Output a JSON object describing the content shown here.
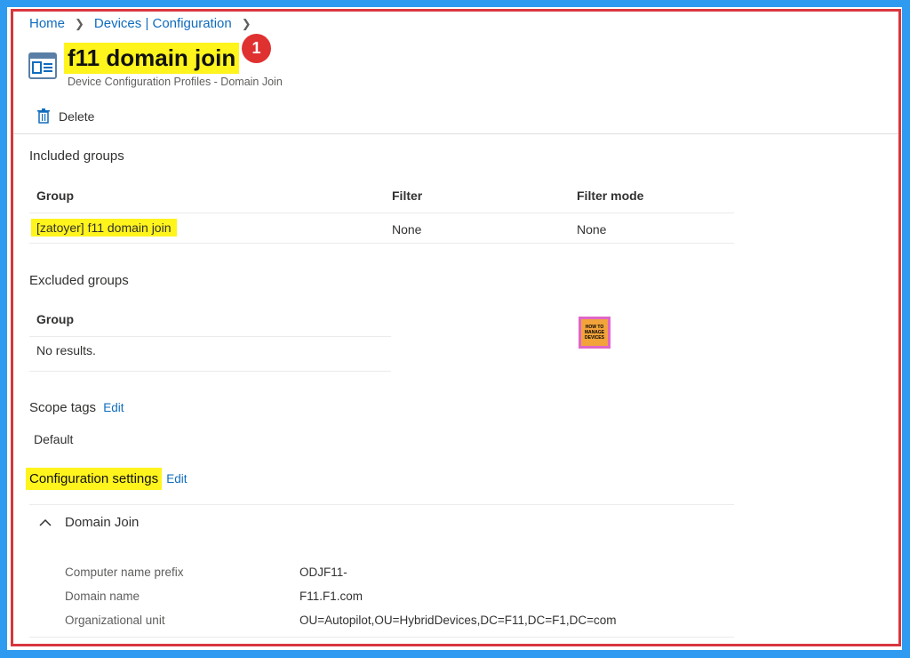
{
  "breadcrumb": {
    "home": "Home",
    "devices_config": "Devices | Configuration"
  },
  "header": {
    "title": "f11 domain join",
    "subtitle": "Device Configuration Profiles - Domain Join",
    "step_badge": "1"
  },
  "toolbar": {
    "delete_label": "Delete"
  },
  "included_groups": {
    "title": "Included groups",
    "columns": [
      "Group",
      "Filter",
      "Filter mode"
    ],
    "rows": [
      {
        "group": "[zatoyer] f11 domain join",
        "filter": "None",
        "filter_mode": "None"
      }
    ]
  },
  "excluded_groups": {
    "title": "Excluded groups",
    "column": "Group",
    "empty": "No results."
  },
  "scope_tags": {
    "title": "Scope tags",
    "edit_label": "Edit",
    "value": "Default"
  },
  "configuration_settings": {
    "title": "Configuration settings",
    "edit_label": "Edit",
    "section": "Domain Join",
    "items": [
      {
        "label": "Computer name prefix",
        "value": "ODJF11-"
      },
      {
        "label": "Domain name",
        "value": "F11.F1.com"
      },
      {
        "label": "Organizational unit",
        "value": "OU=Autopilot,OU=HybridDevices,DC=F11,DC=F1,DC=com"
      }
    ]
  },
  "logo": {
    "line1": "HOW TO",
    "line2": "MANAGE",
    "line3": "DEVICES"
  },
  "colors": {
    "highlight": "#fff41c",
    "link": "#0f6cbd",
    "border": "#d9363e",
    "badge": "#e03131",
    "background": "#2f9bf0"
  }
}
